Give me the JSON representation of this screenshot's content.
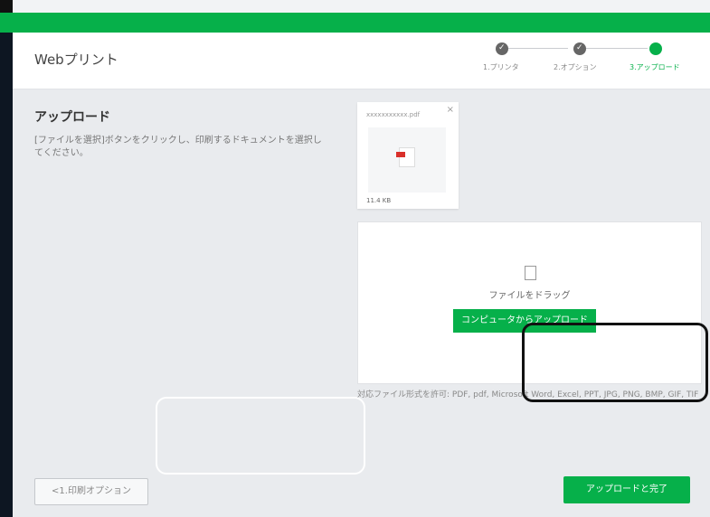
{
  "window": {
    "brand_color": "#06b04a",
    "sidebar_color": "#0d1622"
  },
  "header": {
    "title": "Webプリント",
    "steps": [
      {
        "label": "1.プリンタ",
        "state": "done"
      },
      {
        "label": "2.オプション",
        "state": "done"
      },
      {
        "label": "3.アップロード",
        "state": "active"
      }
    ],
    "check_icon": "✓"
  },
  "main": {
    "heading": "アップロード",
    "description": "[ファイルを選択]ボタンをクリックし、印刷するドキュメントを選択してください。",
    "file": {
      "name": "xxxxxxxxxxx.pdf",
      "size": "11.4 KB",
      "close_label": "×"
    },
    "dropzone": {
      "drop_text": "ファイルをドラッグ",
      "upload_button": "コンピュータからアップロード"
    },
    "note": "対応ファイル形式を許可: PDF, pdf, Microsoft Word, Excel, PPT, JPG, PNG, BMP, GIF, TIF"
  },
  "footer": {
    "back_button": "<1.印刷オプション",
    "done_button": "アップロードと完了"
  }
}
